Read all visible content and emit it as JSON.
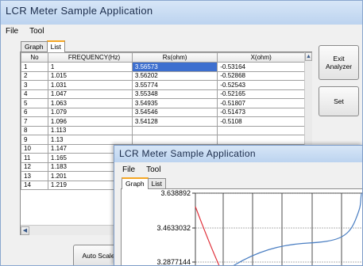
{
  "main_window": {
    "title": "LCR Meter Sample Application",
    "menu": [
      "File",
      "Tool"
    ],
    "tabs": [
      "Graph",
      "List"
    ],
    "active_tab": "List",
    "buttons": {
      "exit": "Exit\nAnalyzer",
      "set": "Set",
      "auto_scale": "Auto Scale"
    },
    "table": {
      "columns": [
        "No",
        "FREQUENCY(Hz)",
        "Rs(ohm)",
        "X(ohm)"
      ],
      "rows": [
        [
          "1",
          "1",
          "3.56573",
          "-0.53164"
        ],
        [
          "2",
          "1.015",
          "3.56202",
          "-0.52868"
        ],
        [
          "3",
          "1.031",
          "3.55774",
          "-0.52543"
        ],
        [
          "4",
          "1.047",
          "3.55348",
          "-0.52165"
        ],
        [
          "5",
          "1.063",
          "3.54935",
          "-0.51807"
        ],
        [
          "6",
          "1.079",
          "3.54546",
          "-0.51473"
        ],
        [
          "7",
          "1.096",
          "3.54128",
          "-0.5108"
        ],
        [
          "8",
          "1.113",
          "",
          ""
        ],
        [
          "9",
          "1.13",
          "",
          ""
        ],
        [
          "10",
          "1.147",
          "",
          ""
        ],
        [
          "11",
          "1.165",
          "",
          ""
        ],
        [
          "12",
          "1.183",
          "",
          ""
        ],
        [
          "13",
          "1.201",
          "",
          ""
        ],
        [
          "14",
          "1.219",
          "",
          ""
        ]
      ]
    }
  },
  "graph_window": {
    "title": "LCR Meter Sample Application",
    "menu": [
      "File",
      "Tool"
    ],
    "tabs": [
      "Graph",
      "List"
    ],
    "active_tab": "Graph"
  },
  "chart_data": {
    "type": "line",
    "y_ticks": [
      "3.638892",
      "3.4633032",
      "3.2877144"
    ],
    "ylim": [
      3.2877144,
      3.638892
    ],
    "grid": true,
    "colors": {
      "series_rs": "#4a7ec2",
      "series_x": "#e0303a"
    }
  }
}
